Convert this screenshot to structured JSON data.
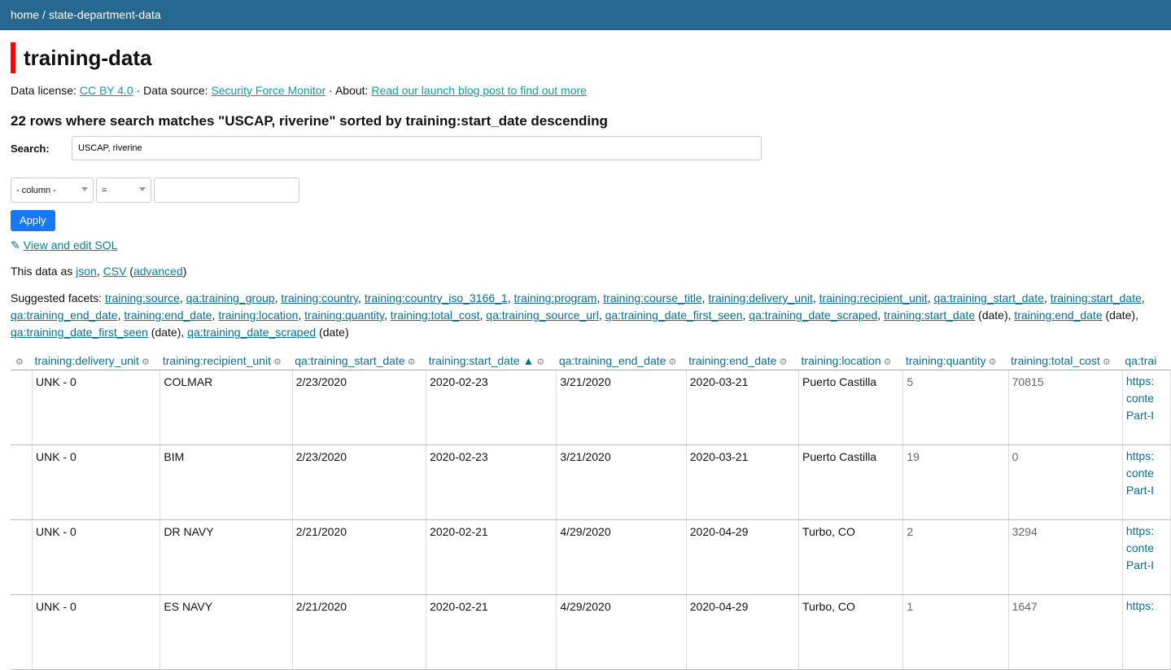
{
  "breadcrumb": {
    "home": "home",
    "sep": "/",
    "db": "state-department-data"
  },
  "page_title": "training-data",
  "meta": {
    "license_label": "Data license:",
    "license": "CC BY 4.0",
    "dot1": "·",
    "source_label": "Data source:",
    "source": "Security Force Monitor",
    "dot2": "·",
    "about_label": "About:",
    "about": "Read our launch blog post to find out more"
  },
  "summary": "22 rows where search matches \"USCAP, riverine\" sorted by training:start_date descending",
  "search": {
    "label": "Search:",
    "value": "USCAP, riverine"
  },
  "filter": {
    "column": "- column -",
    "op": "=",
    "apply": "Apply"
  },
  "sql_link": "View and edit SQL",
  "exports": {
    "prefix": "This data as",
    "json": "json",
    "comma": ",",
    "csv": "CSV",
    "advanced": "advanced"
  },
  "facets": {
    "label": "Suggested facets:",
    "items": [
      {
        "name": "training:source",
        "suffix": ","
      },
      {
        "name": "qa:training_group",
        "suffix": ","
      },
      {
        "name": "training:country",
        "suffix": ","
      },
      {
        "name": "training:country_iso_3166_1",
        "suffix": ","
      },
      {
        "name": "training:program",
        "suffix": ","
      },
      {
        "name": "training:course_title",
        "suffix": ","
      },
      {
        "name": "training:delivery_unit",
        "suffix": ","
      },
      {
        "name": "training:recipient_unit",
        "suffix": ","
      },
      {
        "name": "qa:training_start_date",
        "suffix": ","
      },
      {
        "name": "training:start_date",
        "suffix": ","
      },
      {
        "name": "qa:training_end_date",
        "suffix": ","
      },
      {
        "name": "training:end_date",
        "suffix": ","
      },
      {
        "name": "training:location",
        "suffix": ","
      },
      {
        "name": "training:quantity",
        "suffix": ","
      },
      {
        "name": "training:total_cost",
        "suffix": ","
      },
      {
        "name": "qa:training_source_url",
        "suffix": ","
      },
      {
        "name": "qa:training_date_first_seen",
        "suffix": ","
      },
      {
        "name": "qa:training_date_scraped",
        "suffix": ","
      },
      {
        "name": "training:start_date",
        "suffix": " (date),"
      },
      {
        "name": "training:end_date",
        "suffix": " (date),"
      },
      {
        "name": "qa:training_date_first_seen",
        "suffix": " (date),"
      },
      {
        "name": "qa:training_date_scraped",
        "suffix": " (date)"
      }
    ]
  },
  "table": {
    "columns": [
      {
        "label": "",
        "w": 27
      },
      {
        "label": "training:delivery_unit",
        "w": 158
      },
      {
        "label": "training:recipient_unit",
        "w": 163
      },
      {
        "label": "qa:training_start_date",
        "w": 165
      },
      {
        "label": "training:start_date ▲",
        "w": 161
      },
      {
        "label": "qa:training_end_date",
        "w": 160
      },
      {
        "label": "training:end_date",
        "w": 139
      },
      {
        "label": "training:location",
        "w": 129
      },
      {
        "label": "training:quantity",
        "w": 130
      },
      {
        "label": "training:total_cost",
        "w": 141
      },
      {
        "label": "qa:trai",
        "w": 60
      }
    ],
    "rows": [
      [
        "",
        "UNK - 0",
        "COLMAR",
        "2/23/2020",
        "2020-02-23",
        "3/21/2020",
        "2020-03-21",
        "Puerto Castilla",
        "5",
        "70815",
        "https:\nconte\nPart-I"
      ],
      [
        "",
        "UNK - 0",
        "BIM",
        "2/23/2020",
        "2020-02-23",
        "3/21/2020",
        "2020-03-21",
        "Puerto Castilla",
        "19",
        "0",
        "https:\nconte\nPart-I"
      ],
      [
        "",
        "UNK - 0",
        "DR NAVY",
        "2/21/2020",
        "2020-02-21",
        "4/29/2020",
        "2020-04-29",
        "Turbo, CO",
        "2",
        "3294",
        "https:\nconte\nPart-I"
      ],
      [
        "",
        "UNK - 0",
        "ES NAVY",
        "2/21/2020",
        "2020-02-21",
        "4/29/2020",
        "2020-04-29",
        "Turbo, CO",
        "1",
        "1647",
        "https:"
      ]
    ]
  }
}
